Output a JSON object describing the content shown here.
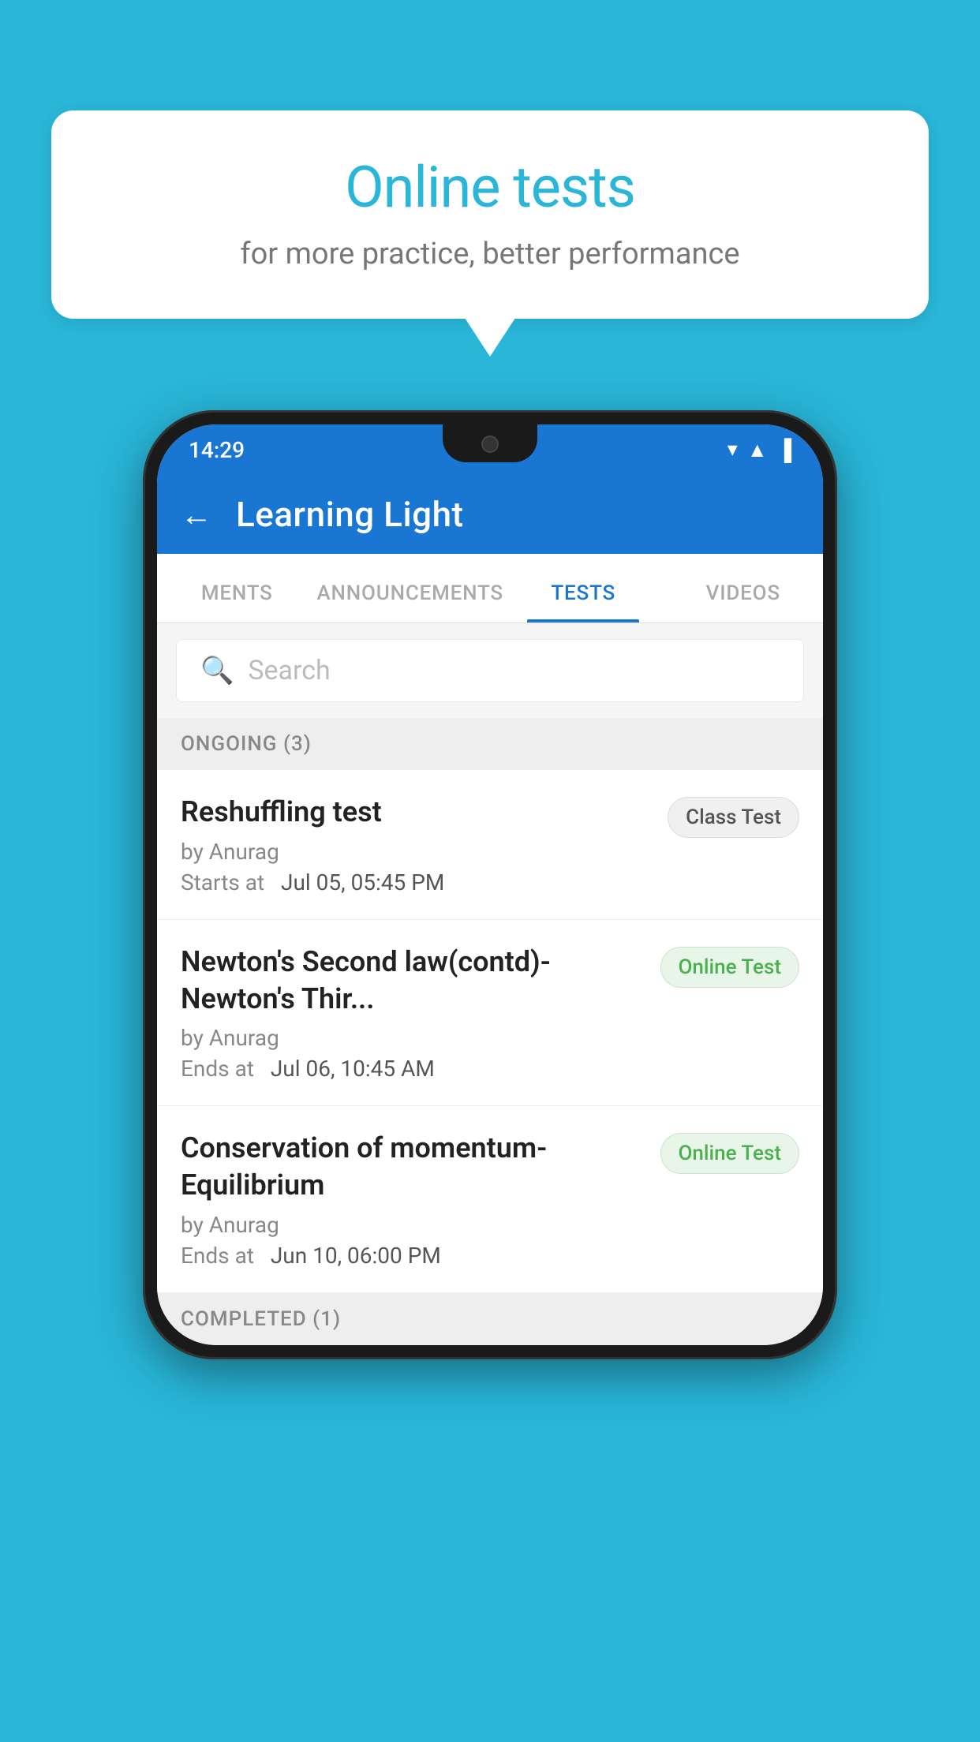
{
  "background": {
    "color": "#29B6D8"
  },
  "speech_bubble": {
    "title": "Online tests",
    "subtitle": "for more practice, better performance"
  },
  "status_bar": {
    "time": "14:29",
    "icons": [
      "▲",
      "▲",
      "▐"
    ]
  },
  "app_header": {
    "back_label": "←",
    "title": "Learning Light"
  },
  "tabs": [
    {
      "label": "MENTS",
      "active": false
    },
    {
      "label": "ANNOUNCEMENTS",
      "active": false
    },
    {
      "label": "TESTS",
      "active": true
    },
    {
      "label": "VIDEOS",
      "active": false
    }
  ],
  "search": {
    "placeholder": "Search"
  },
  "ongoing_section": {
    "label": "ONGOING (3)"
  },
  "tests": [
    {
      "title": "Reshuffling test",
      "author": "by Anurag",
      "time_label": "Starts at",
      "time_value": "Jul 05, 05:45 PM",
      "badge": "Class Test",
      "badge_type": "class"
    },
    {
      "title": "Newton's Second law(contd)-Newton's Thir...",
      "author": "by Anurag",
      "time_label": "Ends at",
      "time_value": "Jul 06, 10:45 AM",
      "badge": "Online Test",
      "badge_type": "online"
    },
    {
      "title": "Conservation of momentum-Equilibrium",
      "author": "by Anurag",
      "time_label": "Ends at",
      "time_value": "Jun 10, 06:00 PM",
      "badge": "Online Test",
      "badge_type": "online"
    }
  ],
  "completed_section": {
    "label": "COMPLETED (1)"
  }
}
